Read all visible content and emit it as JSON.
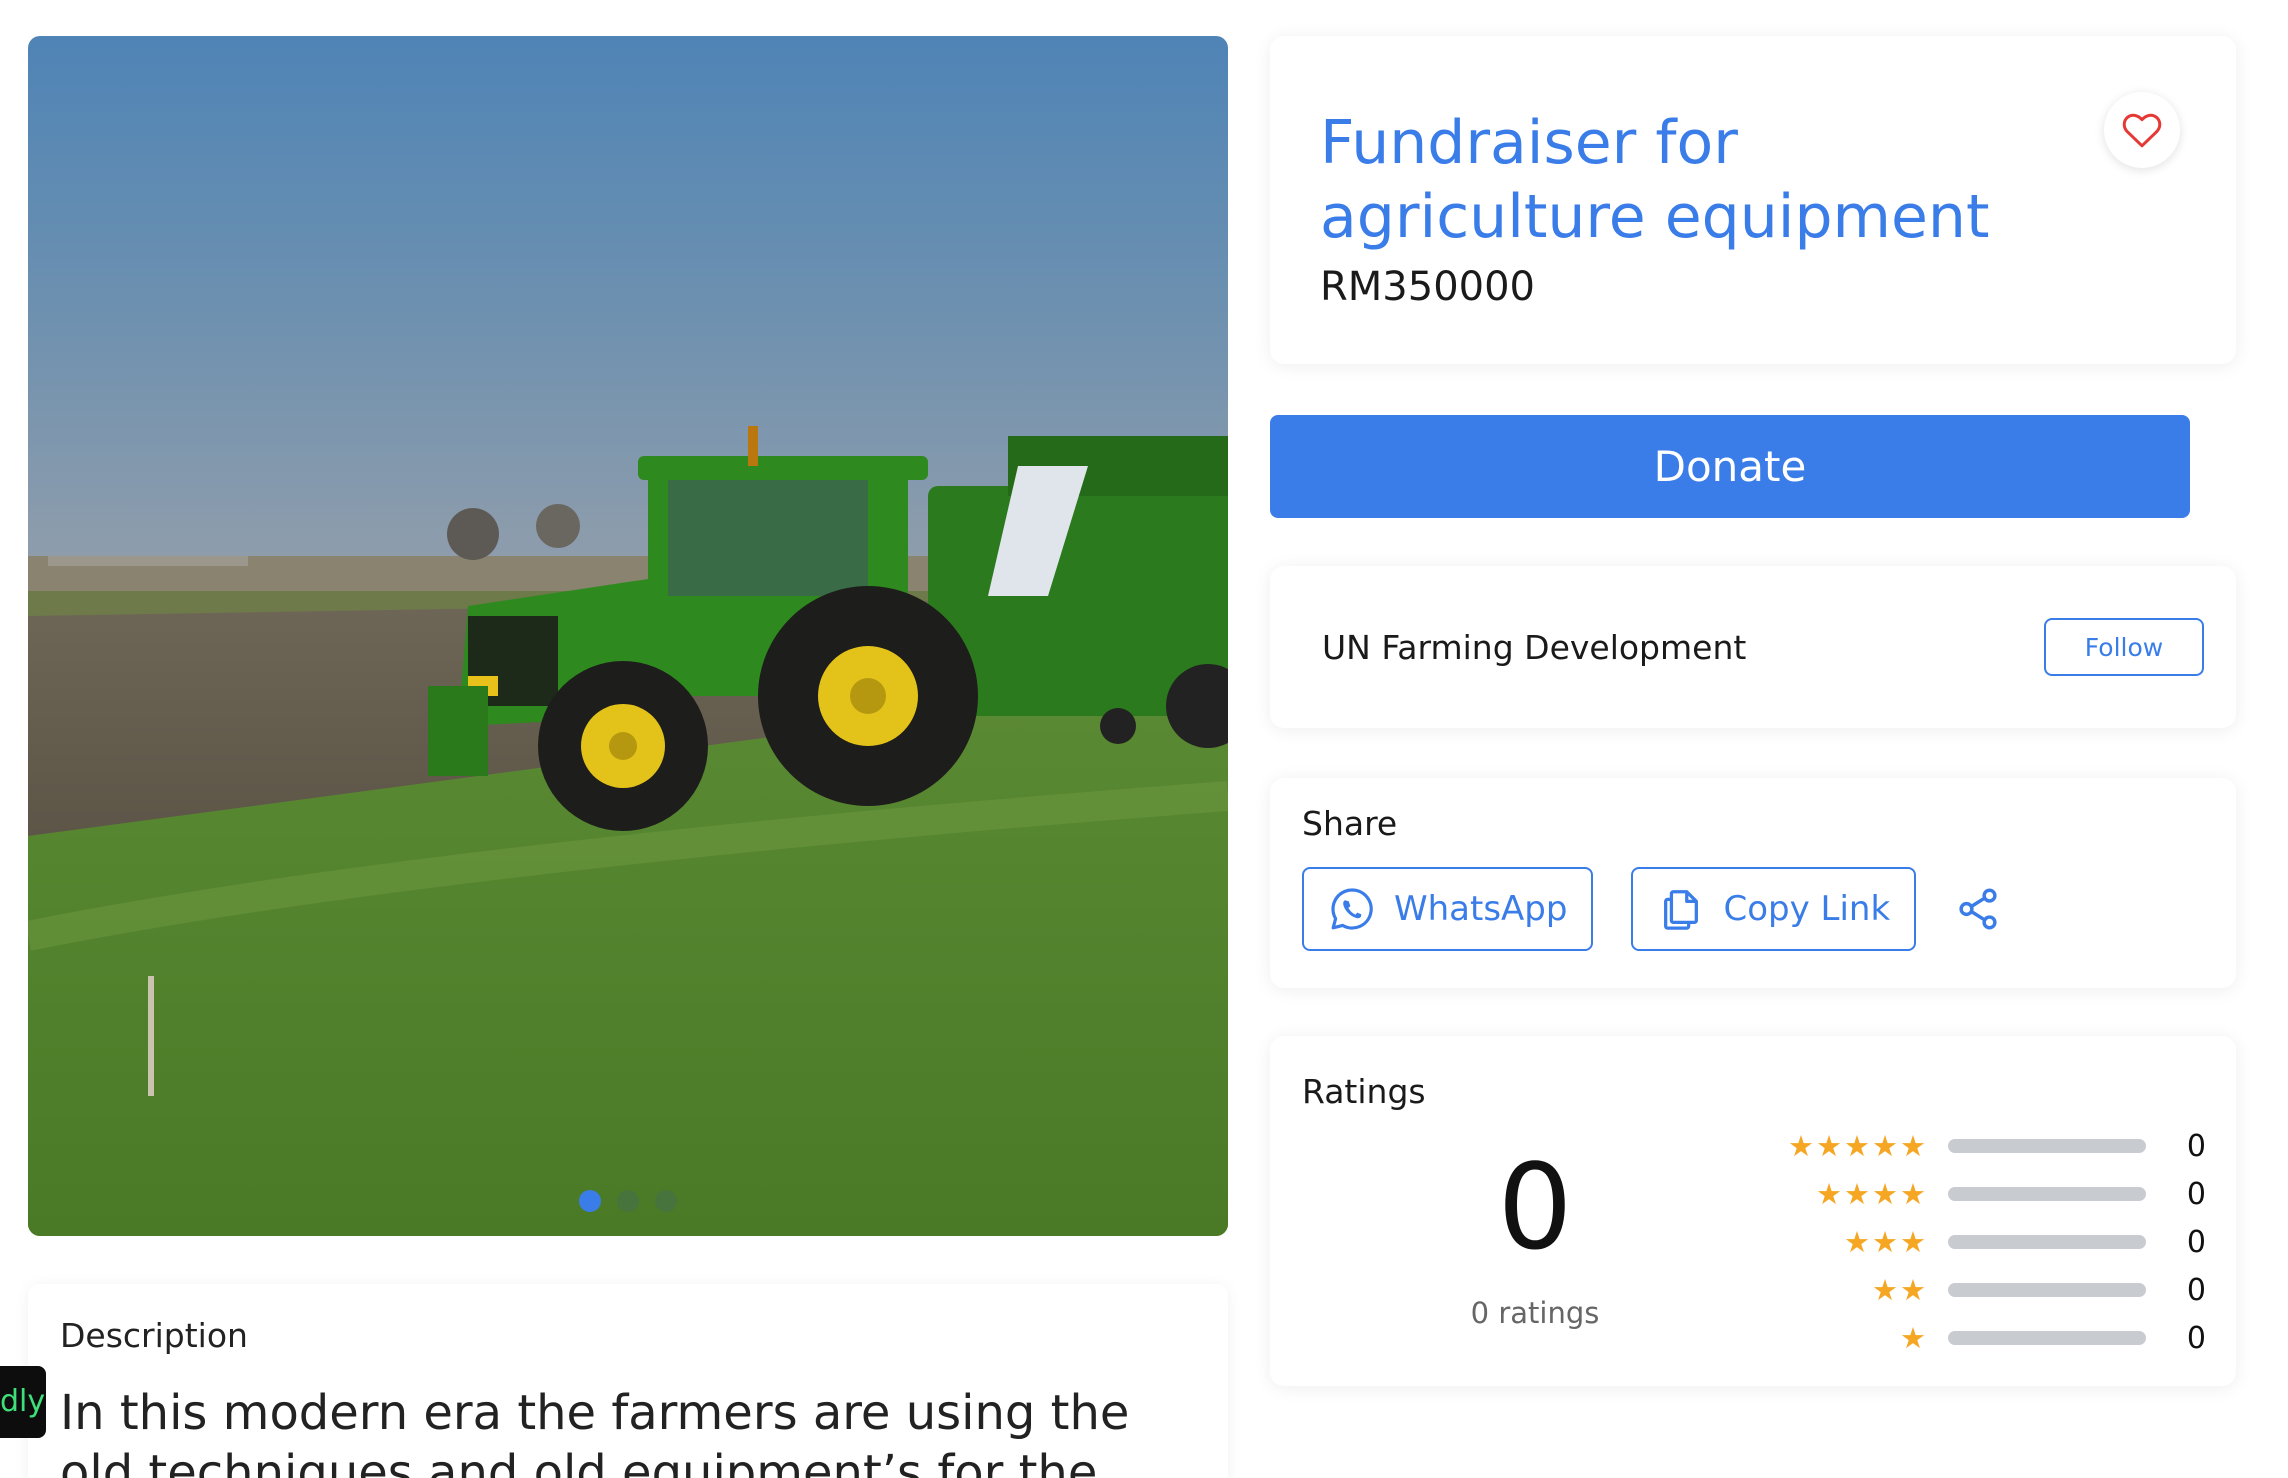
{
  "hero": {
    "image_alt": "Green tractor with baler on a grass field",
    "carousel": {
      "count": 3,
      "active": 0
    }
  },
  "description": {
    "title": "Description",
    "text": "In this modern era the farmers are using the old techniques and old equipment’s for the"
  },
  "side_badge": {
    "text": "dly"
  },
  "fundraiser": {
    "title": "Fundraiser for agriculture equipment",
    "amount": "RM350000"
  },
  "donate": {
    "label": "Donate"
  },
  "organizer": {
    "name": "UN Farming Development",
    "follow_label": "Follow"
  },
  "share": {
    "heading": "Share",
    "whatsapp_label": "WhatsApp",
    "copy_label": "Copy Link"
  },
  "ratings": {
    "heading": "Ratings",
    "average": "0",
    "count_label": "0 ratings",
    "rows": [
      {
        "stars": "★★★★★",
        "count": "0"
      },
      {
        "stars": "★★★★",
        "count": "0"
      },
      {
        "stars": "★★★",
        "count": "0"
      },
      {
        "stars": "★★",
        "count": "0"
      },
      {
        "stars": "★",
        "count": "0"
      }
    ]
  },
  "colors": {
    "accent": "#3a7de8",
    "star": "#f5a623",
    "heart": "#e53935"
  }
}
